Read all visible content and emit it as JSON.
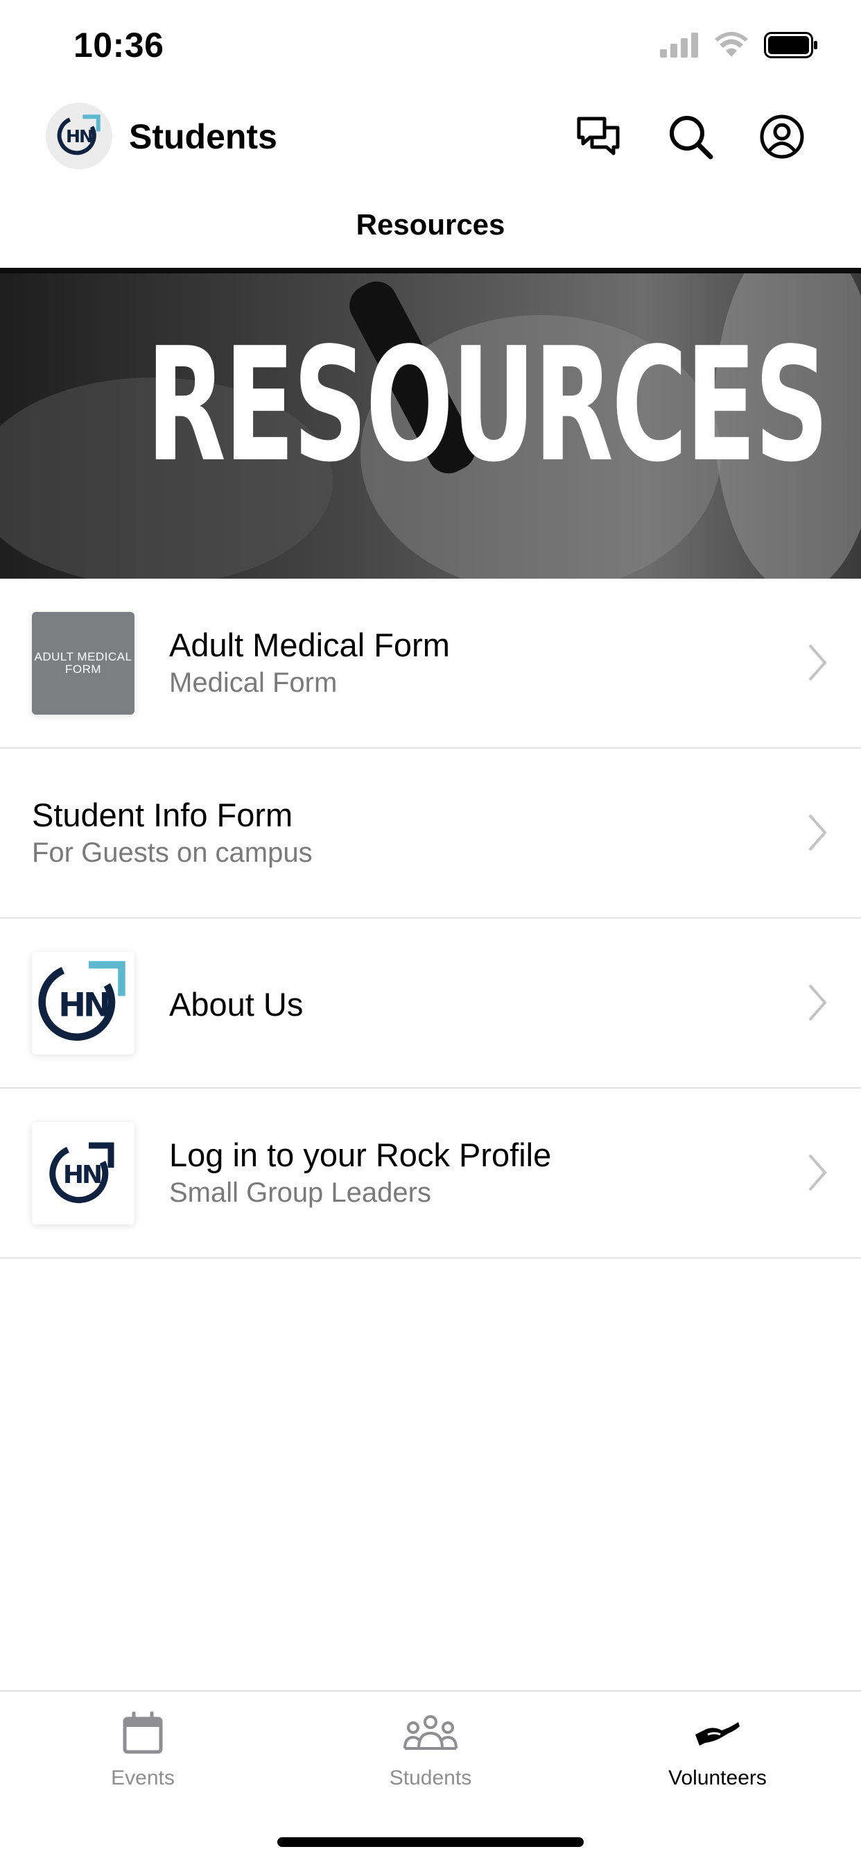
{
  "status_bar": {
    "time": "10:36"
  },
  "header": {
    "logo_text": "HN",
    "title": "Students",
    "icons": [
      "chat-icon",
      "search-icon",
      "profile-icon"
    ]
  },
  "page": {
    "title": "Resources"
  },
  "hero": {
    "text": "RESOURCES"
  },
  "list": [
    {
      "title": "Adult Medical Form",
      "subtitle": "Medical Form",
      "thumb_text": "ADULT MEDICAL FORM"
    },
    {
      "title": "Student Info Form",
      "subtitle": "For Guests on campus"
    },
    {
      "title": "About Us",
      "thumb_text": "HN"
    },
    {
      "title": "Log in to your Rock Profile",
      "subtitle": "Small Group Leaders",
      "thumb_text": "HN"
    }
  ],
  "tabs": [
    {
      "label": "Events",
      "icon": "calendar-icon",
      "active": false
    },
    {
      "label": "Students",
      "icon": "group-icon",
      "active": false
    },
    {
      "label": "Volunteers",
      "icon": "helping-hand-icon",
      "active": true
    }
  ],
  "colors": {
    "accent": "#5bb8cf",
    "navy": "#0f2240",
    "inactive": "#8e8e93",
    "subtitle": "#7a7a7a"
  }
}
